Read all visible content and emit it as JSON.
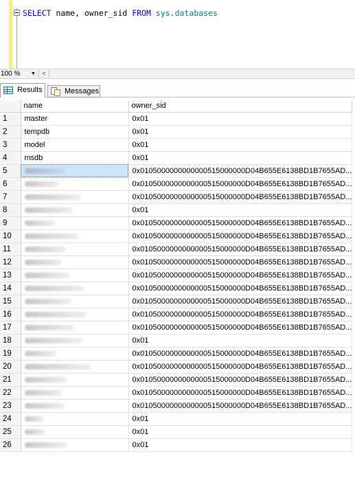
{
  "editor": {
    "query_tokens": [
      {
        "text": "SELECT",
        "kind": "kw"
      },
      {
        "text": " name, owner_sid ",
        "kind": "pl"
      },
      {
        "text": "FROM",
        "kind": "kw"
      },
      {
        "text": " ",
        "kind": "pl"
      },
      {
        "text": "sys.databases",
        "kind": "ob"
      }
    ]
  },
  "zoom": {
    "value": "100 %"
  },
  "tabs": {
    "results_label": "Results",
    "messages_label": "Messages"
  },
  "grid": {
    "columns": [
      "name",
      "owner_sid"
    ],
    "selected_row": 5,
    "rows": [
      {
        "n": "1",
        "name": "master",
        "sid": "0x01"
      },
      {
        "n": "2",
        "name": "tempdb",
        "sid": "0x01"
      },
      {
        "n": "3",
        "name": "model",
        "sid": "0x01"
      },
      {
        "n": "4",
        "name": "msdb",
        "sid": "0x01"
      },
      {
        "n": "5",
        "name": "",
        "sid": "0x0105000000000000515000000D04B655E6138BD1B7655AD..."
      },
      {
        "n": "6",
        "name": "",
        "sid": "0x0105000000000000515000000D04B655E6138BD1B7655AD..."
      },
      {
        "n": "7",
        "name": "",
        "sid": "0x0105000000000000515000000D04B655E6138BD1B7655AD..."
      },
      {
        "n": "8",
        "name": "",
        "sid": "0x01"
      },
      {
        "n": "9",
        "name": "",
        "sid": "0x0105000000000000515000000D04B655E6138BD1B7655AD..."
      },
      {
        "n": "10",
        "name": "",
        "sid": "0x0105000000000000515000000D04B655E6138BD1B7655AD..."
      },
      {
        "n": "11",
        "name": "",
        "sid": "0x0105000000000000515000000D04B655E6138BD1B7655AD..."
      },
      {
        "n": "12",
        "name": "",
        "sid": "0x0105000000000000515000000D04B655E6138BD1B7655AD..."
      },
      {
        "n": "13",
        "name": "",
        "sid": "0x0105000000000000515000000D04B655E6138BD1B7655AD..."
      },
      {
        "n": "14",
        "name": "",
        "sid": "0x0105000000000000515000000D04B655E6138BD1B7655AD..."
      },
      {
        "n": "15",
        "name": "",
        "sid": "0x0105000000000000515000000D04B655E6138BD1B7655AD..."
      },
      {
        "n": "16",
        "name": "",
        "sid": "0x0105000000000000515000000D04B655E6138BD1B7655AD..."
      },
      {
        "n": "17",
        "name": "",
        "sid": "0x0105000000000000515000000D04B655E6138BD1B7655AD..."
      },
      {
        "n": "18",
        "name": "",
        "sid": "0x01"
      },
      {
        "n": "19",
        "name": "",
        "sid": "0x0105000000000000515000000D04B655E6138BD1B7655AD..."
      },
      {
        "n": "20",
        "name": "",
        "sid": "0x0105000000000000515000000D04B655E6138BD1B7655AD..."
      },
      {
        "n": "21",
        "name": "",
        "sid": "0x0105000000000000515000000D04B655E6138BD1B7655AD..."
      },
      {
        "n": "22",
        "name": "",
        "sid": "0x0105000000000000515000000D04B655E6138BD1B7655AD..."
      },
      {
        "n": "23",
        "name": "",
        "sid": "0x0105000000000000515000000D04B655E6138BD1B7655AD..."
      },
      {
        "n": "24",
        "name": "",
        "sid": "0x01"
      },
      {
        "n": "25",
        "name": "",
        "sid": "0x01"
      },
      {
        "n": "26",
        "name": "",
        "sid": "0x01"
      }
    ]
  },
  "colors": {
    "keyword": "#0000ff",
    "object": "#008080",
    "selection": "#cce4f7",
    "gutter": "#ffee62"
  }
}
